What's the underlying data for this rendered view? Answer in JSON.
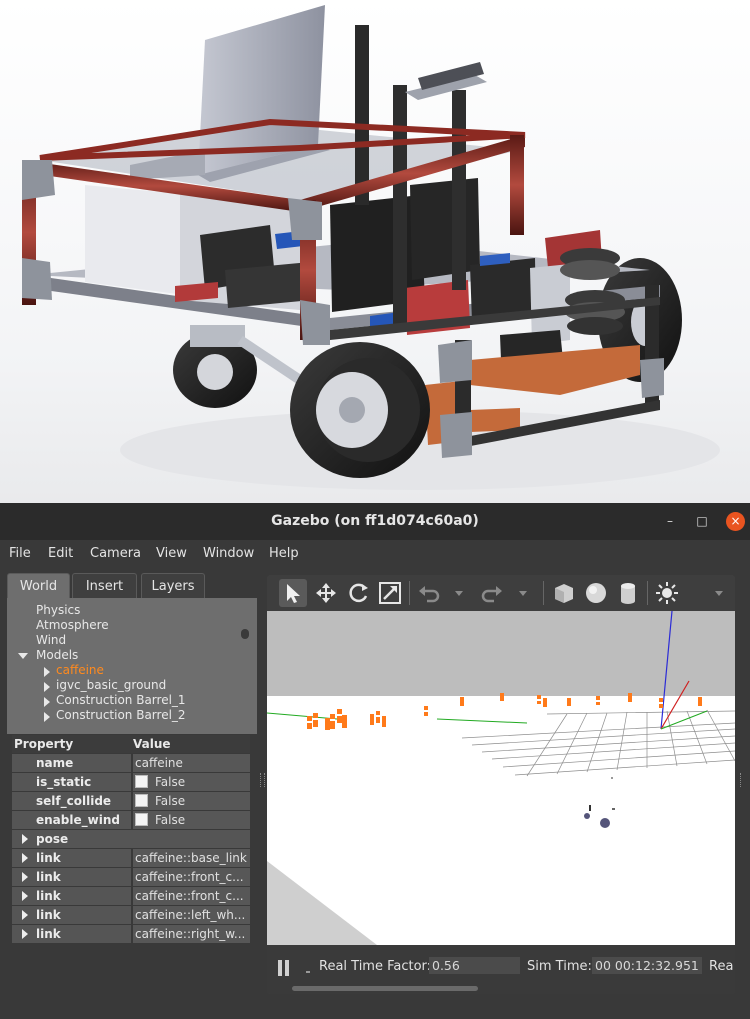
{
  "window": {
    "title": "Gazebo (on ff1d074c60a0)"
  },
  "window_controls": {
    "minimize": "–",
    "maximize": "□",
    "close": "×"
  },
  "menu": {
    "file": "File",
    "edit": "Edit",
    "camera": "Camera",
    "view": "View",
    "window": "Window",
    "help": "Help"
  },
  "tabs": {
    "world": "World",
    "insert": "Insert",
    "layers": "Layers"
  },
  "tree": {
    "physics": "Physics",
    "atmosphere": "Atmosphere",
    "wind": "Wind",
    "models": "Models",
    "model_items": [
      "caffeine",
      "igvc_basic_ground",
      "Construction Barrel_1",
      "Construction Barrel_2"
    ],
    "selected_color": "#ff8a1e"
  },
  "properties": {
    "header_property": "Property",
    "header_value": "Value",
    "rows": [
      {
        "key": "name",
        "value": "caffeine"
      },
      {
        "key": "is_static",
        "value": "False",
        "checkbox": true
      },
      {
        "key": "self_collide",
        "value": "False",
        "checkbox": true
      },
      {
        "key": "enable_wind",
        "value": "False",
        "checkbox": true
      },
      {
        "key": "pose",
        "value": ""
      },
      {
        "key": "link",
        "value": "caffeine::base_link"
      },
      {
        "key": "link",
        "value": "caffeine::front_c..."
      },
      {
        "key": "link",
        "value": "caffeine::front_c..."
      },
      {
        "key": "link",
        "value": "caffeine::left_wh..."
      },
      {
        "key": "link",
        "value": "caffeine::right_w..."
      }
    ]
  },
  "toolbar": {
    "icons": [
      "select-arrow-icon",
      "translate-icon",
      "rotate-icon",
      "scale-icon",
      "undo-icon",
      "redo-icon",
      "box-shape-icon",
      "sphere-shape-icon",
      "cylinder-shape-icon",
      "sun-light-icon"
    ]
  },
  "status": {
    "rtf_label": "Real Time Factor:",
    "rtf_value": "0.56",
    "sim_time_label": "Sim Time:",
    "sim_time_value": "00 00:12:32.951",
    "real_label": "Rea"
  },
  "colors": {
    "accent": "#e95420",
    "selection": "#ff8a1e",
    "cone_orange": "#ff7a1a",
    "frame_red": "#8c2a22"
  }
}
